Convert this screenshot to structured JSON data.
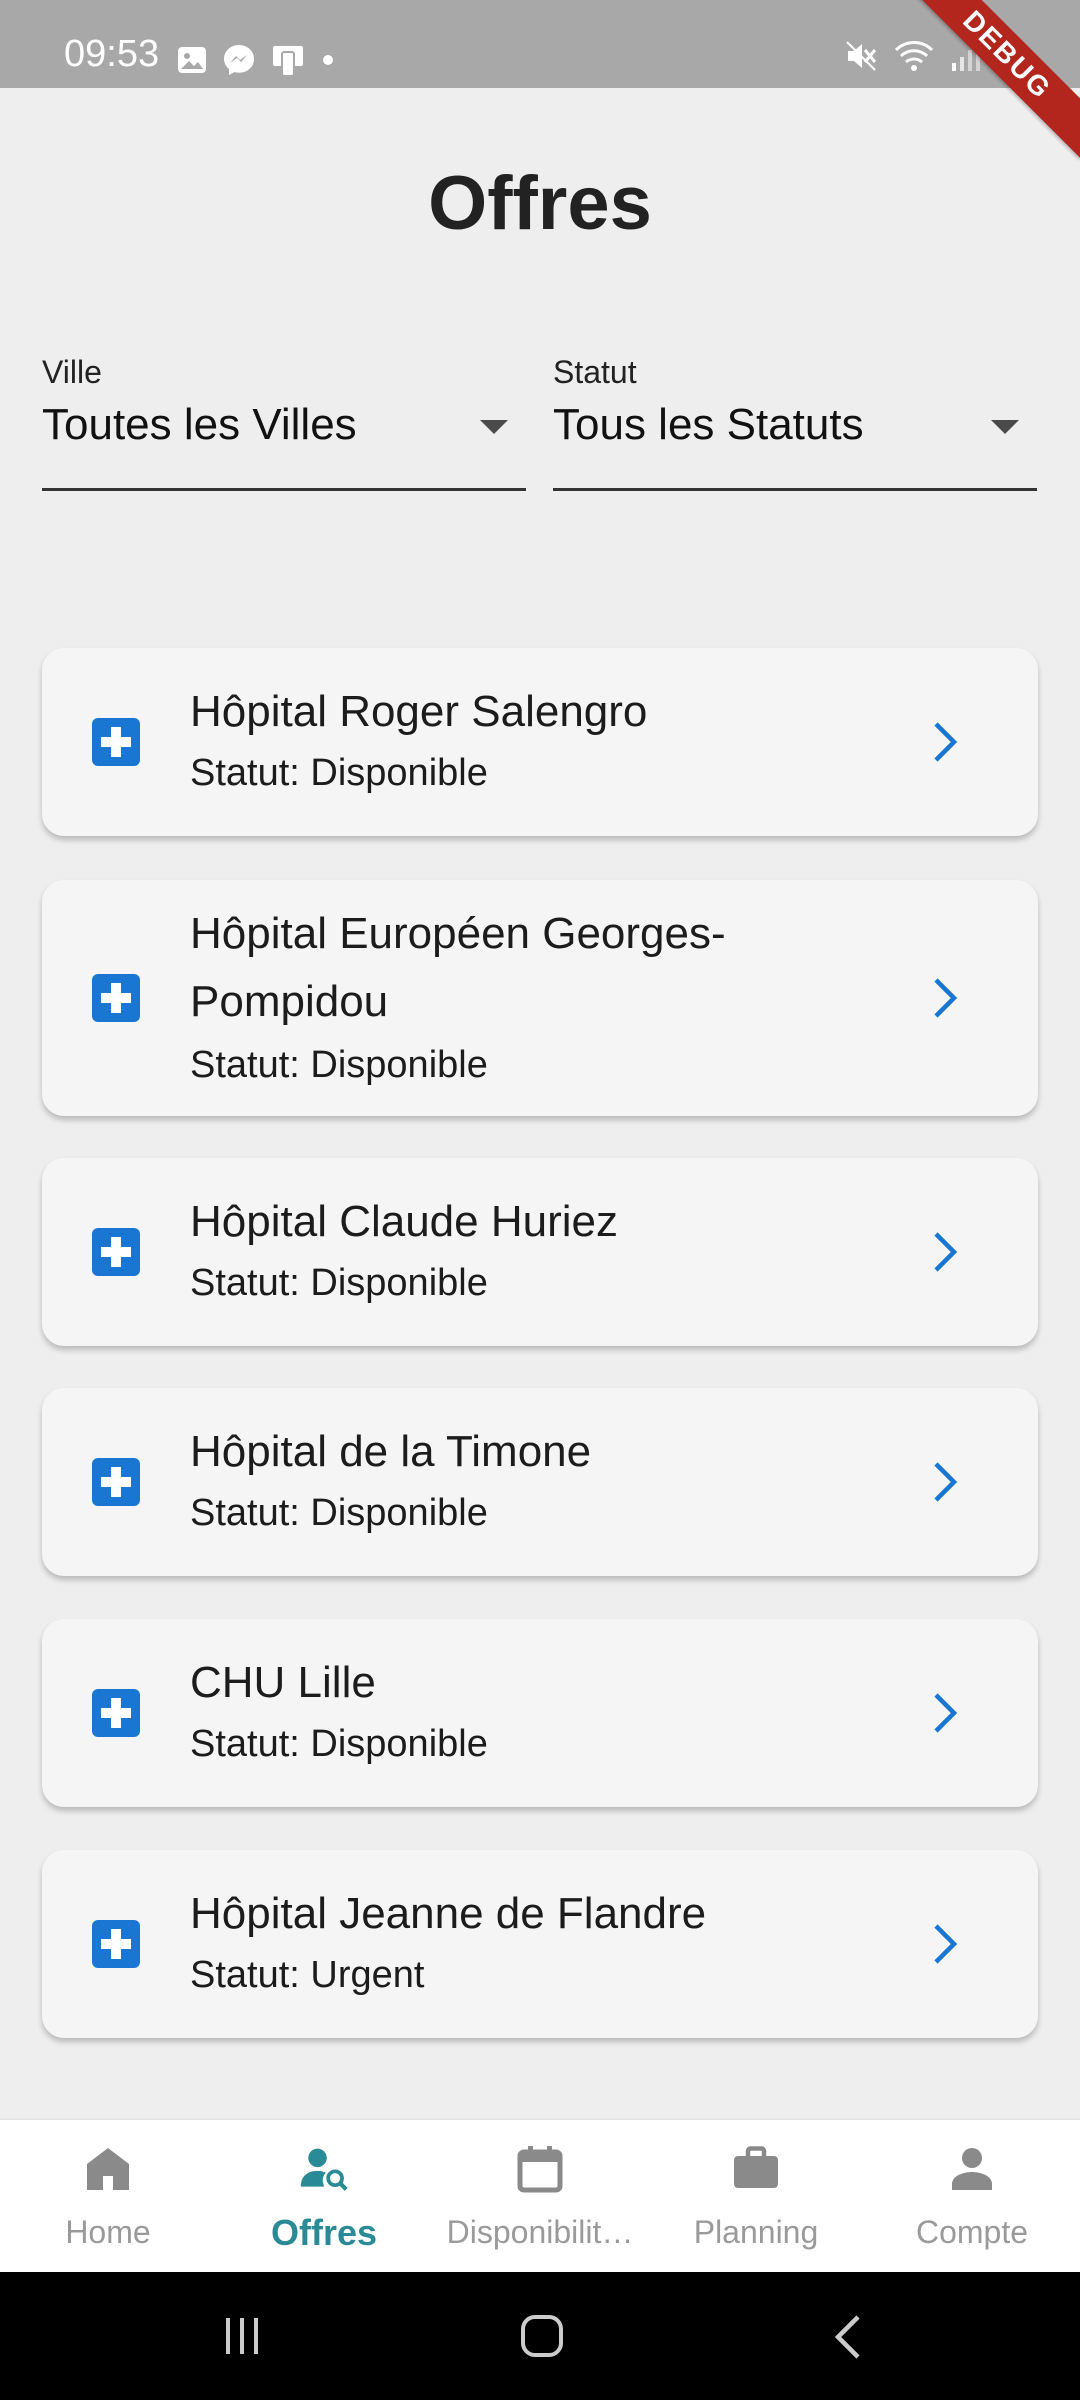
{
  "status_bar": {
    "time": "09:53",
    "left_icons": [
      "image-icon",
      "messenger-icon",
      "device-icon",
      "dot-icon"
    ],
    "right_icons": [
      "mute-icon",
      "wifi-icon",
      "signal-icon",
      "battery-icon"
    ],
    "debug_banner": "DEBUG"
  },
  "page": {
    "title": "Offres"
  },
  "filters": {
    "city": {
      "label": "Ville",
      "value": "Toutes les Villes"
    },
    "status": {
      "label": "Statut",
      "value": "Tous les Statuts"
    }
  },
  "offers": [
    {
      "name": "Hôpital Roger Salengro",
      "status": "Statut: Disponible"
    },
    {
      "name": "Hôpital Européen Georges-Pompidou",
      "status": "Statut: Disponible"
    },
    {
      "name": "Hôpital Claude Huriez",
      "status": "Statut: Disponible"
    },
    {
      "name": "Hôpital de la Timone",
      "status": "Statut: Disponible"
    },
    {
      "name": "CHU Lille",
      "status": "Statut: Disponible"
    },
    {
      "name": "Hôpital Jeanne de Flandre",
      "status": "Statut: Urgent"
    }
  ],
  "bottom_nav": {
    "items": [
      {
        "label": "Home",
        "icon": "home-icon"
      },
      {
        "label": "Offres",
        "icon": "person-search-icon"
      },
      {
        "label": "Disponibilit…",
        "icon": "calendar-icon"
      },
      {
        "label": "Planning",
        "icon": "briefcase-icon"
      },
      {
        "label": "Compte",
        "icon": "person-icon"
      }
    ],
    "active_index": 1
  },
  "system_nav": {
    "buttons": [
      "recents-icon",
      "home-circle-icon",
      "back-icon"
    ]
  },
  "colors": {
    "accent": "#2a8a96",
    "icon_blue": "#1976d2",
    "background": "#eeeeee",
    "card": "#f5f5f5",
    "status_bar": "#a8a8a8",
    "debug_ribbon": "#b3261e"
  }
}
